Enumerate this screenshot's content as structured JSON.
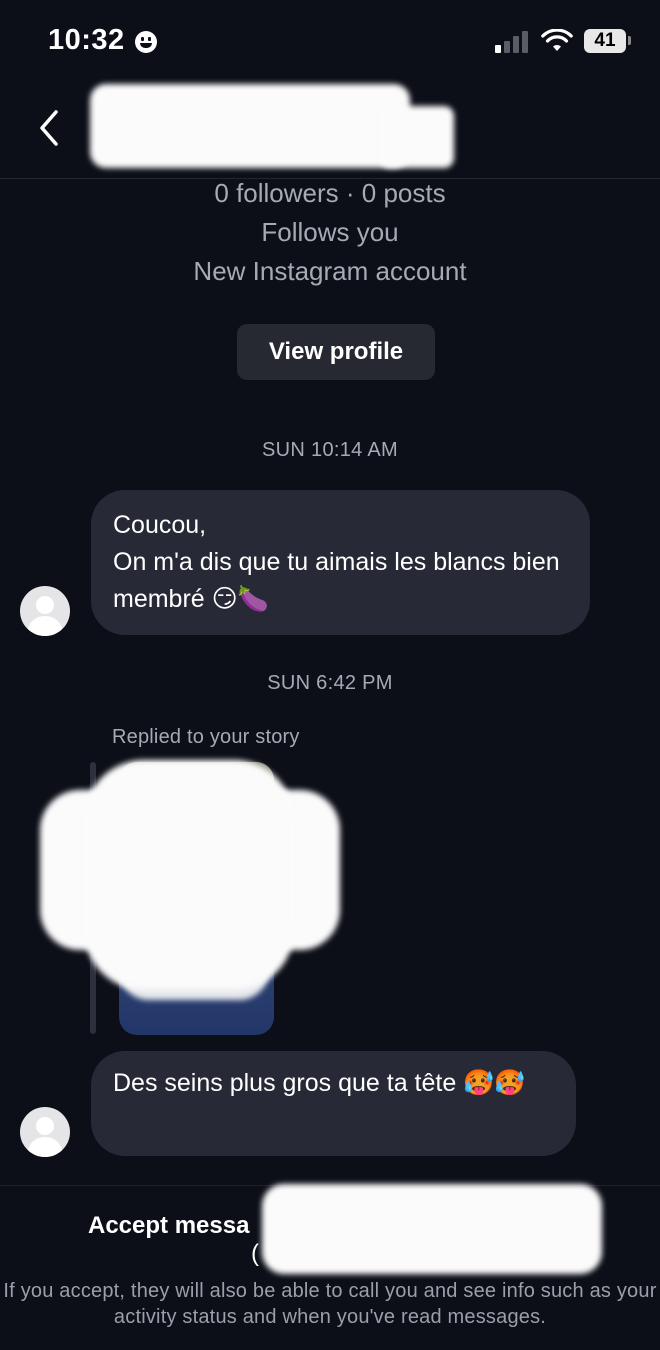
{
  "status_bar": {
    "time": "10:32",
    "battery": "41"
  },
  "profile": {
    "stats": "0 followers · 0 posts",
    "follows_you": "Follows you",
    "account_note": "New Instagram account",
    "view_profile_label": "View profile"
  },
  "messages": [
    {
      "timestamp": "SUN 10:14 AM",
      "text": "Coucou,\nOn m'a dis que tu aimais les blancs bien membré 😏🍆"
    },
    {
      "timestamp": "SUN 6:42 PM",
      "reply_label": "Replied to your story",
      "text": "Des seins plus gros que ta tête 🥵🥵"
    }
  ],
  "footer": {
    "accept_label": "Accept messa",
    "paren": "(",
    "note": "If you accept, they will also be able to call you and see info such as your activity status and when you've read messages."
  },
  "colors": {
    "background": "#0c0e18",
    "bubble": "#272a36",
    "secondary_text": "#a7a9b3"
  }
}
